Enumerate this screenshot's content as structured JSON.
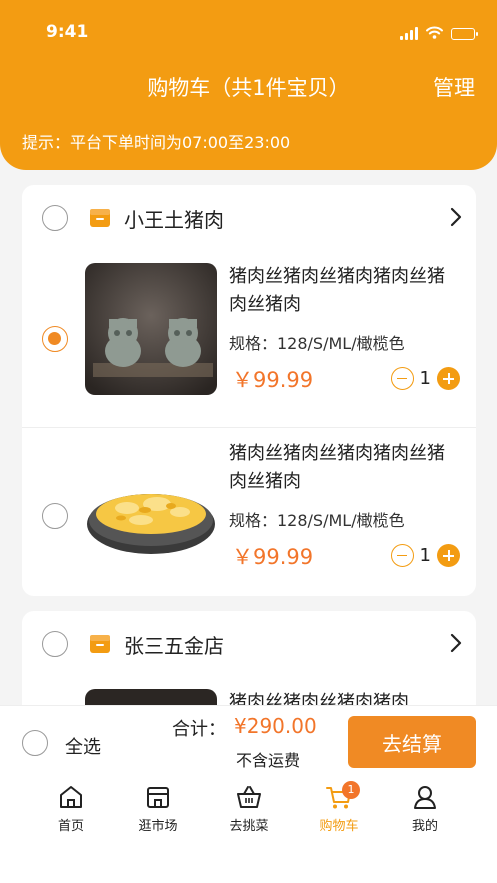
{
  "status_bar": {
    "time": "9:41"
  },
  "header": {
    "title": "购物车（共1件宝贝）",
    "manage_label": "管理",
    "hint": "提示：平台下单时间为07:00至23:00"
  },
  "shops": [
    {
      "name": "小王土猪肉",
      "items": [
        {
          "name": "猪肉丝猪肉丝猪肉猪肉丝猪肉丝猪肉",
          "spec": "规格：128/S/ML/橄榄色",
          "price": "￥99.99",
          "qty": "1",
          "checked": true,
          "image": "dragon-figurines"
        },
        {
          "name": "猪肉丝猪肉丝猪肉猪肉丝猪肉丝猪肉",
          "spec": "规格：128/S/ML/橄榄色",
          "price": "￥99.99",
          "qty": "1",
          "checked": false,
          "image": "scrambled-eggs-bowl"
        }
      ]
    },
    {
      "name": "张三五金店",
      "items": [
        {
          "name": "猪肉丝猪肉丝猪肉猪肉",
          "image": "dark-product"
        }
      ]
    }
  ],
  "checkout": {
    "select_all": "全选",
    "total_label": "合计：",
    "total_value": "¥290.00",
    "shipping_note": "不含运费",
    "pay_button": "去结算"
  },
  "tabbar": {
    "tabs": [
      {
        "label": "首页",
        "icon": "home-icon"
      },
      {
        "label": "逛市场",
        "icon": "store-icon"
      },
      {
        "label": "去挑菜",
        "icon": "basket-icon"
      },
      {
        "label": "购物车",
        "icon": "cart-icon",
        "badge": "1",
        "active": true
      },
      {
        "label": "我的",
        "icon": "user-icon"
      }
    ]
  },
  "colors": {
    "accent": "#f39c12",
    "price": "#f2752a",
    "button": "#f08a24"
  }
}
